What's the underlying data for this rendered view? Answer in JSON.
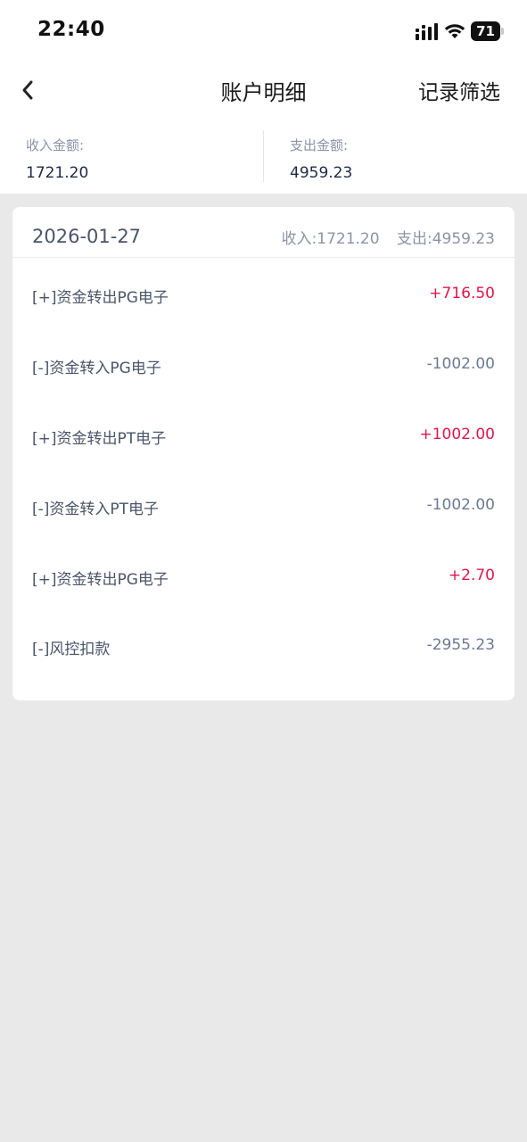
{
  "status_bar": {
    "time": "22:40",
    "battery": "71",
    "icons": [
      "signal-icon",
      "wifi-icon",
      "battery-icon"
    ]
  },
  "nav": {
    "back_icon": "chevron-left-icon",
    "title": "账户明细",
    "filter_label": "记录筛选"
  },
  "summary": {
    "income_label": "收入金额:",
    "income_value": "1721.20",
    "expense_label": "支出金额:",
    "expense_value": "4959.23"
  },
  "day_card": {
    "date": "2026-01-27",
    "income_total": "收入:1721.20",
    "expense_total": "支出:4959.23",
    "rows": [
      {
        "label": "[+]资金转出PG电子",
        "amount": "+716.50",
        "kind": "positive"
      },
      {
        "label": "[-]资金转入PG电子",
        "amount": "-1002.00",
        "kind": "negative"
      },
      {
        "label": "[+]资金转出PT电子",
        "amount": "+1002.00",
        "kind": "positive"
      },
      {
        "label": "[-]资金转入PT电子",
        "amount": "-1002.00",
        "kind": "negative"
      },
      {
        "label": "[+]资金转出PG电子",
        "amount": "+2.70",
        "kind": "positive"
      },
      {
        "label": "[-]风控扣款",
        "amount": "-2955.23",
        "kind": "negative"
      }
    ]
  },
  "colors": {
    "positive": "#e0164a",
    "negative": "#6b7a93",
    "page_background": "#e9e9e9"
  }
}
